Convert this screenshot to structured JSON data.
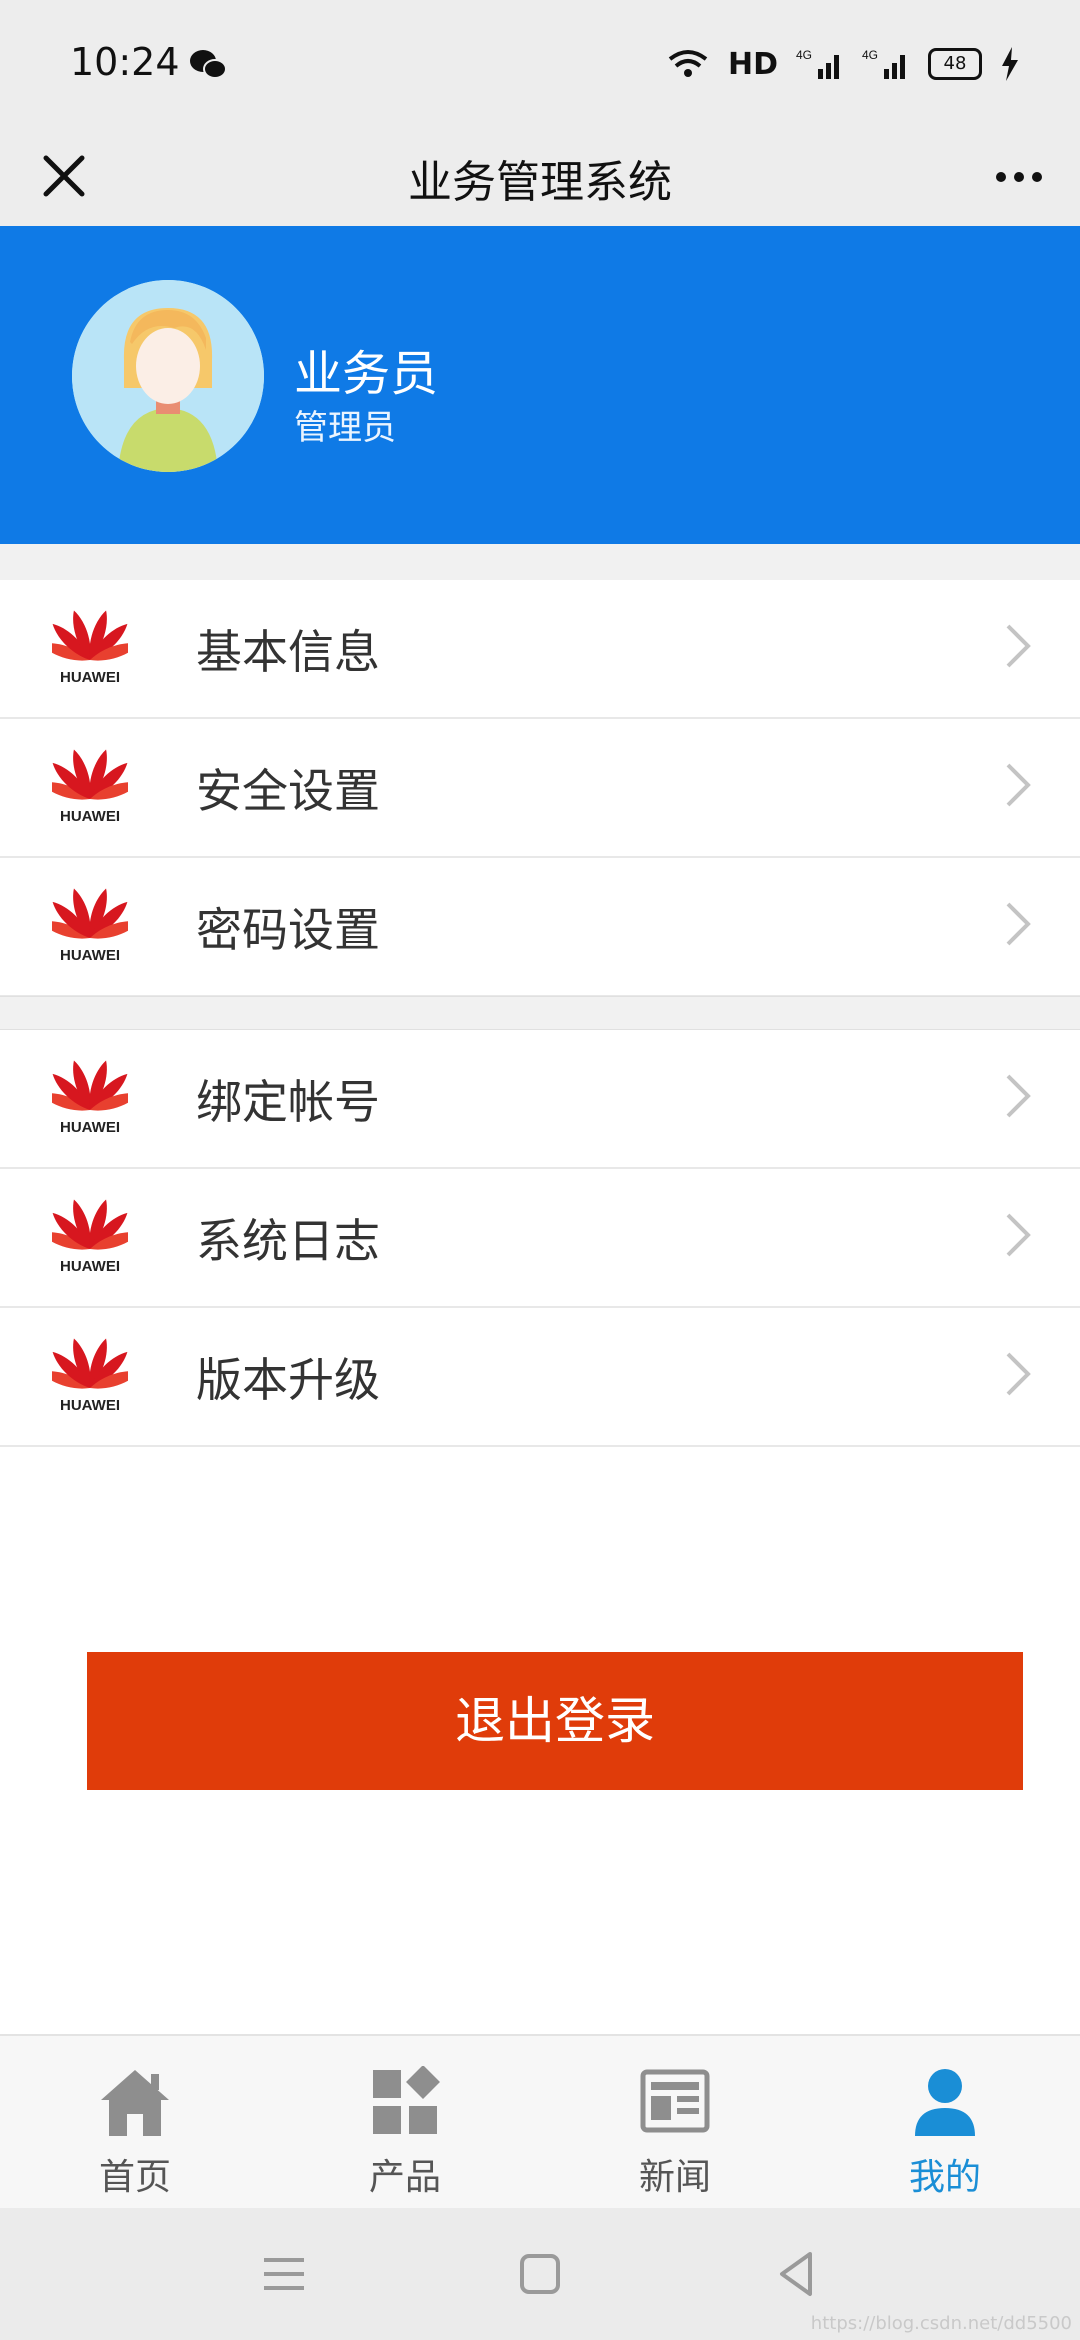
{
  "status_bar": {
    "time": "10:24",
    "network": "HD",
    "battery": "48",
    "icons": [
      "wechat-icon",
      "wifi-icon",
      "signal-4g-icon",
      "signal-4g-icon",
      "battery-icon",
      "charging-icon"
    ]
  },
  "title_bar": {
    "title": "业务管理系统",
    "close_icon": "close-icon",
    "more_icon": "more-icon"
  },
  "profile": {
    "name": "业务员",
    "role": "管理员",
    "background_color": "#0f7ae6"
  },
  "menu": {
    "groups": [
      {
        "items": [
          {
            "label": "基本信息",
            "logo_text": "HUAWEI"
          },
          {
            "label": "安全设置",
            "logo_text": "HUAWEI"
          },
          {
            "label": "密码设置",
            "logo_text": "HUAWEI"
          }
        ]
      },
      {
        "items": [
          {
            "label": "绑定帐号",
            "logo_text": "HUAWEI"
          },
          {
            "label": "系统日志",
            "logo_text": "HUAWEI"
          },
          {
            "label": "版本升级",
            "logo_text": "HUAWEI"
          }
        ]
      }
    ]
  },
  "logout": {
    "label": "退出登录",
    "color": "#e03c0a"
  },
  "tabbar": {
    "items": [
      {
        "label": "首页",
        "icon": "home-icon",
        "active": false
      },
      {
        "label": "产品",
        "icon": "grid-icon",
        "active": false
      },
      {
        "label": "新闻",
        "icon": "news-icon",
        "active": false
      },
      {
        "label": "我的",
        "icon": "user-icon",
        "active": true
      }
    ],
    "active_color": "#1a8ed6"
  },
  "system_nav": {
    "icons": [
      "menu-icon",
      "home-square-icon",
      "back-triangle-icon"
    ]
  },
  "watermark": "https://blog.csdn.net/dd5500"
}
